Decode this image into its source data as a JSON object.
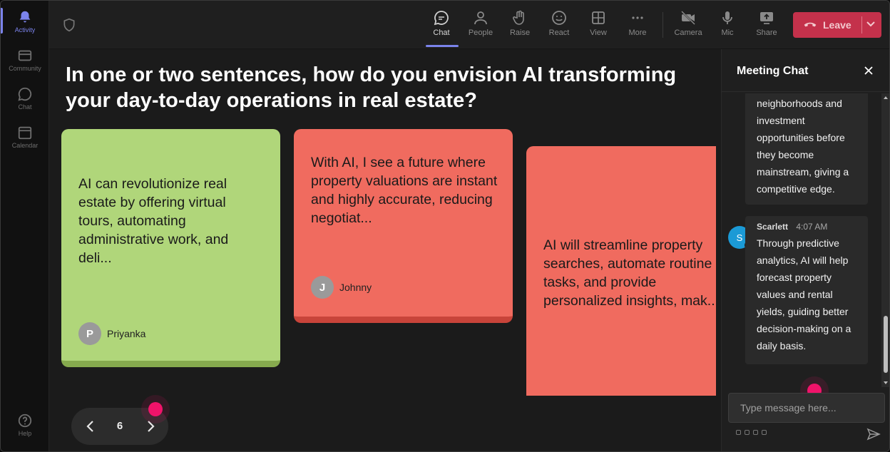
{
  "rail": {
    "items": [
      {
        "label": "Activity",
        "icon": "bell-icon",
        "active": true
      },
      {
        "label": "Community",
        "icon": "community-icon",
        "active": false
      },
      {
        "label": "Chat",
        "icon": "chat-icon",
        "active": false
      },
      {
        "label": "Calendar",
        "icon": "calendar-icon",
        "active": false
      }
    ],
    "help_label": "Help"
  },
  "toolbar": {
    "chat": "Chat",
    "people": "People",
    "raise": "Raise",
    "react": "React",
    "view": "View",
    "more": "More",
    "camera": "Camera",
    "mic": "Mic",
    "share": "Share",
    "leave": "Leave"
  },
  "stage": {
    "question": "In one or two sentences, how do you envision AI transforming your day-to-day operations in real estate?",
    "cards": [
      {
        "text": "AI can revolutionize real estate by offering virtual tours, automating administrative work, and deli...",
        "author": "Priyanka",
        "initial": "P",
        "color": "#b0d67a"
      },
      {
        "text": "With AI, I see a future where property valuations are instant and highly accurate, reducing negotiat...",
        "author": "Johnny",
        "initial": "J",
        "color": "#f06b5f"
      },
      {
        "text": "AI will streamline property searches, automate routine tasks, and provide personalized insights, mak...",
        "color": "#f06b5f"
      }
    ],
    "page_number": "6"
  },
  "chat": {
    "title": "Meeting Chat",
    "messages": [
      {
        "text": "neighborhoods and investment opportunities before they become mainstream, giving a competitive edge."
      },
      {
        "sender": "Scarlett",
        "initial": "S",
        "time": "4:07 AM",
        "text": "Through predictive analytics, AI will help forecast property values and rental yields, guiding better decision-making on a daily basis."
      }
    ],
    "input_placeholder": "Type message here..."
  },
  "colors": {
    "accent": "#7b83eb",
    "leave": "#c4314b",
    "highlight_dot": "#f0136a"
  }
}
